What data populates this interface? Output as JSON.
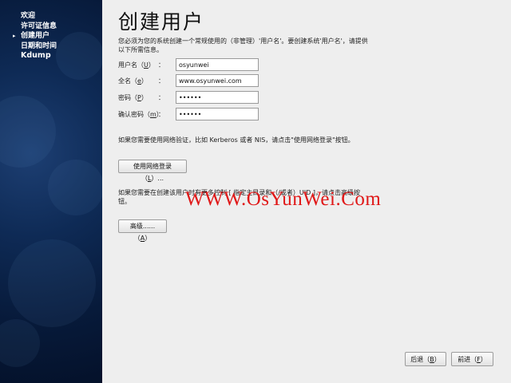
{
  "sidebar": {
    "items": [
      {
        "label": "欢迎",
        "current": false
      },
      {
        "label": "许可证信息",
        "current": false
      },
      {
        "label": "创建用户",
        "current": true
      },
      {
        "label": "日期和时间",
        "current": false
      },
      {
        "label": "Kdump",
        "current": false
      }
    ],
    "current_marker": "▸"
  },
  "main": {
    "title": "创建用户",
    "intro": "您必须为您的系统创建一个常规使用的（非管理）'用户名'。要创建系统'用户名'，请提供以下所需信息。",
    "fields": {
      "username": {
        "label": "用户名",
        "key": "U",
        "value": "osyunwei"
      },
      "fullname": {
        "label": "全名",
        "key": "e",
        "value": "www.osyunwei.com"
      },
      "password": {
        "label": "密码",
        "key": "P",
        "value": "••••••"
      },
      "confirm": {
        "label": "确认密码",
        "key": "m",
        "value": "••••••"
      }
    },
    "network_text": "如果您需要使用网络验证，比如 Kerberos 或者 NIS，请点击\"使用网络登录\"按钮。",
    "network_button": {
      "label": "使用网络登录",
      "key": "L",
      "suffix": "..."
    },
    "advanced_text_line1": "如果您需要在创建该用户时有更多控制 [ 指定主目录和（/或者）UID ]，请点击高级按",
    "advanced_text_line2": "钮。",
    "advanced_button": {
      "label": "高级......",
      "key": "A"
    },
    "back_button": {
      "label": "后退",
      "key": "B"
    },
    "forward_button": {
      "label": "前进",
      "key": "F"
    },
    "watermark": "WWW.OsYunWei.Com"
  },
  "colors": {
    "sidebar_bg": "#0e2a55",
    "main_bg": "#eeeeee",
    "watermark": "#e01818"
  }
}
